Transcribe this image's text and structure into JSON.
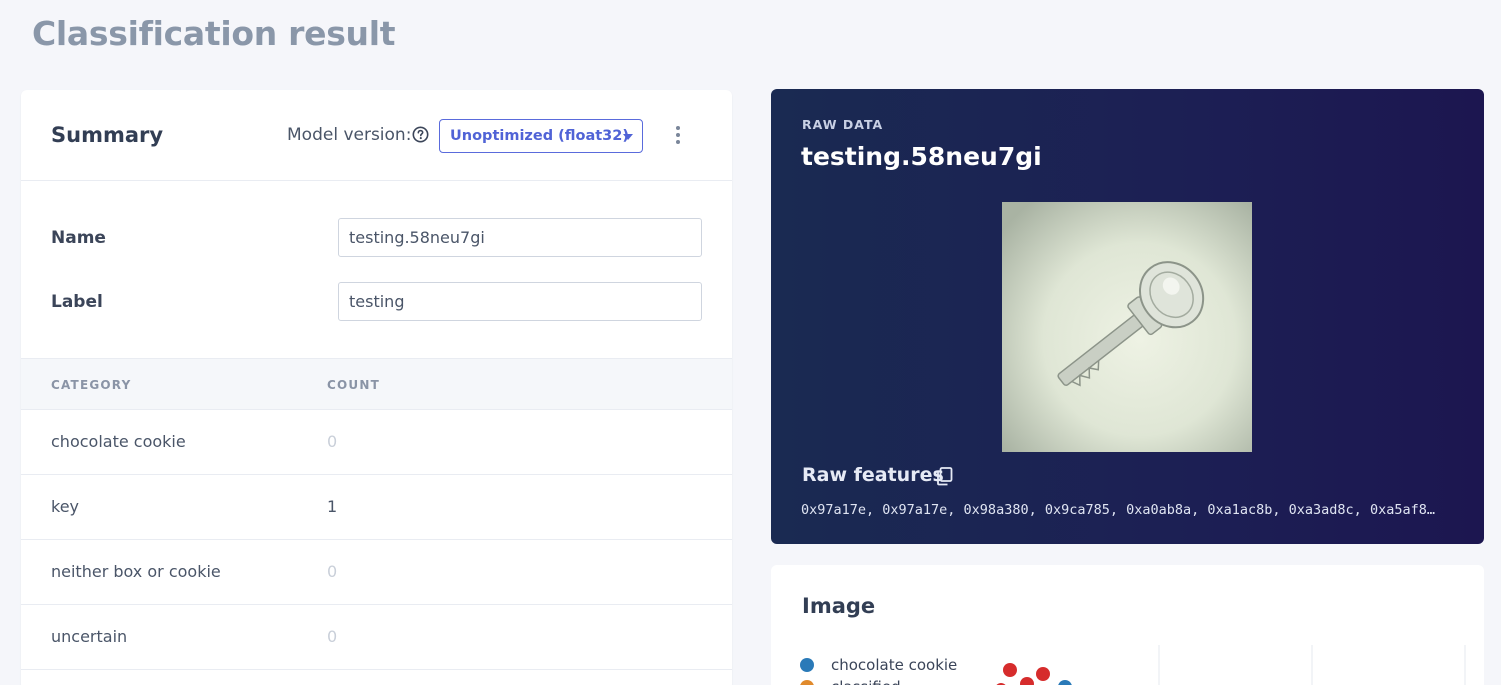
{
  "page": {
    "title": "Classification result"
  },
  "summary": {
    "title": "Summary",
    "model_version_label": "Model version:",
    "model_version_value": "Unoptimized (float32)",
    "fields": {
      "name_label": "Name",
      "name_value": "testing.58neu7gi",
      "label_label": "Label",
      "label_value": "testing"
    },
    "table": {
      "headers": [
        "CATEGORY",
        "COUNT"
      ],
      "rows": [
        {
          "category": "chocolate cookie",
          "count": "0"
        },
        {
          "category": "key",
          "count": "1"
        },
        {
          "category": "neither box or cookie",
          "count": "0"
        },
        {
          "category": "uncertain",
          "count": "0"
        }
      ]
    }
  },
  "raw_data": {
    "eyebrow": "RAW DATA",
    "title": "testing.58neu7gi",
    "features_label": "Raw features",
    "features_value": "0x97a17e, 0x97a17e, 0x98a380, 0x9ca785, 0xa0ab8a, 0xa1ac8b, 0xa3ad8c, 0xa5af8…"
  },
  "image_section": {
    "title": "Image",
    "legend": [
      {
        "label": "chocolate cookie",
        "color": "#2a7ab8"
      },
      {
        "label": "classified",
        "color": "#e08a2c"
      }
    ]
  },
  "colors": {
    "accent": "#5063d6",
    "count_zero": "#c9cfd9",
    "count_nonzero": "#4a5568",
    "scatter_red": "#d62c2c",
    "scatter_blue": "#2a7ab8"
  },
  "icons": {
    "help": "question-circle-icon",
    "caret": "caret-down-icon",
    "menu": "kebab-menu-icon",
    "copy": "copy-icon"
  }
}
